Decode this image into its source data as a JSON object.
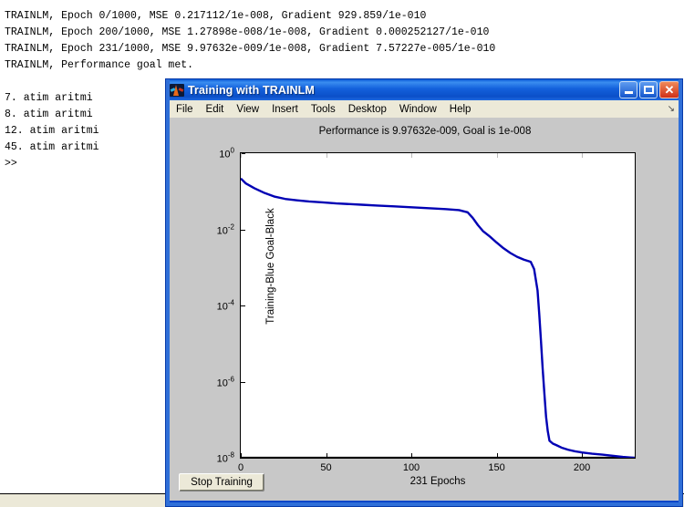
{
  "command_window": {
    "lines": [
      "TRAINLM, Epoch 0/1000, MSE 0.217112/1e-008, Gradient 929.859/1e-010",
      "TRAINLM, Epoch 200/1000, MSE 1.27898e-008/1e-008, Gradient 0.000252127/1e-010",
      "TRAINLM, Epoch 231/1000, MSE 9.97632e-009/1e-008, Gradient 7.57227e-005/1e-010",
      "TRAINLM, Performance goal met.",
      "",
      "7. atim aritmi",
      "8. atim aritmi",
      "12. atim aritmi",
      "45. atim aritmi",
      ">>"
    ]
  },
  "figure_window": {
    "title": "Training with TRAINLM",
    "icon": "matlab-icon",
    "window_buttons": {
      "minimize": "minimize-icon",
      "maximize": "maximize-icon",
      "close": "close-icon"
    },
    "menu": [
      "File",
      "Edit",
      "View",
      "Insert",
      "Tools",
      "Desktop",
      "Window",
      "Help"
    ],
    "dock_icon": "dock-arrow-icon",
    "stop_button": "Stop Training",
    "colors": {
      "titlebar": "#0a58d6",
      "training_curve": "#0000b4",
      "goal_line": "#000000",
      "figure_background": "#c8c8c8",
      "axes_background": "#ffffff"
    }
  },
  "chart_data": {
    "type": "line",
    "title": "Performance is 9.97632e-009, Goal is 1e-008",
    "xlabel": "231 Epochs",
    "ylabel": "Training-Blue  Goal-Black",
    "xlim": [
      0,
      231
    ],
    "ylim": [
      1e-08,
      1
    ],
    "yscale": "log",
    "xticks": [
      0,
      50,
      100,
      150,
      200
    ],
    "yticks": [
      "10^0",
      "10^-2",
      "10^-4",
      "10^-6",
      "10^-8"
    ],
    "ytick_values": [
      1,
      0.01,
      0.0001,
      1e-06,
      1e-08
    ],
    "grid": false,
    "legend": "none",
    "series": [
      {
        "name": "Training-Blue",
        "color": "#0000b4",
        "x": [
          0,
          3,
          8,
          14,
          20,
          26,
          33,
          40,
          48,
          56,
          64,
          72,
          80,
          90,
          100,
          110,
          120,
          128,
          133,
          136,
          139,
          142,
          146,
          150,
          154,
          158,
          162,
          166,
          170,
          172,
          174,
          175,
          176,
          177,
          178,
          179,
          180,
          181,
          183,
          185,
          188,
          192,
          196,
          200,
          206,
          212,
          218,
          224,
          231
        ],
        "y": [
          0.217112,
          0.16,
          0.12,
          0.09,
          0.072,
          0.063,
          0.058,
          0.054,
          0.051,
          0.048,
          0.046,
          0.044,
          0.042,
          0.04,
          0.038,
          0.036,
          0.034,
          0.032,
          0.028,
          0.02,
          0.013,
          0.009,
          0.0065,
          0.0045,
          0.0032,
          0.0024,
          0.0019,
          0.0016,
          0.0014,
          0.0009,
          0.00025,
          6e-05,
          1.2e-05,
          2.2e-06,
          5e-07,
          1.2e-07,
          5e-08,
          2.8e-08,
          2.35e-08,
          2.15e-08,
          1.85e-08,
          1.62e-08,
          1.48e-08,
          1.38e-08,
          1.28e-08,
          1.21e-08,
          1.13e-08,
          1.05e-08,
          9.9763e-09
        ]
      },
      {
        "name": "Goal-Black",
        "color": "#000000",
        "constant_y": 1e-08
      }
    ]
  }
}
